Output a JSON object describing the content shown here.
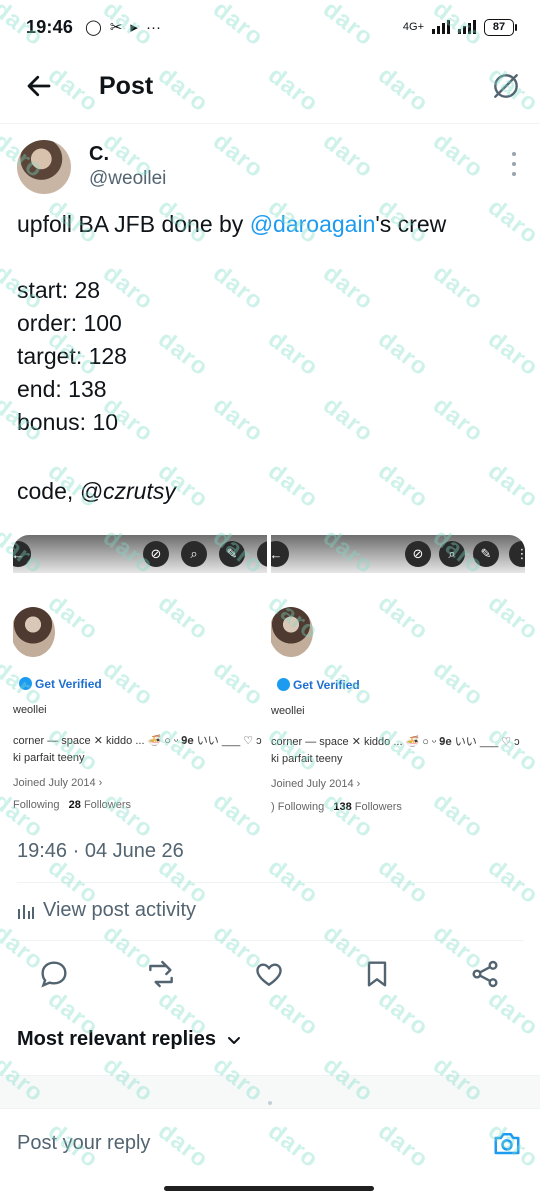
{
  "status_bar": {
    "time": "19:46",
    "network": "4G+",
    "battery": "87"
  },
  "header": {
    "title": "Post"
  },
  "post": {
    "author_name": "C.",
    "author_handle": "@weollei",
    "text_prefix": "upfoll BA JFB done by ",
    "mention": "@daroagain",
    "text_suffix": "'s crew",
    "body": "start: 28\norder: 100\ntarget: 128\nend: 138\nbonus: 10",
    "code_label": "code,",
    "code_value": "@czrutsy",
    "timestamp": "19:46 · 04 June 26",
    "activity": "View post activity"
  },
  "media": {
    "left": {
      "verified_label": "Get Verified",
      "handle": "weollei",
      "bio_line1": "corner — space ✕ kiddo ... 🍜 ○ ᵕ 𝟗𝐞 いい ___ ♡ ɔ",
      "bio_line2": "ki parfait teeny",
      "joined": "Joined July 2014",
      "following_label": "Following",
      "followers_count": "28",
      "followers_label": "Followers"
    },
    "right": {
      "verified_label": "Get Verified",
      "handle": "weollei",
      "bio_line1": "corner — space ✕ kiddo ... 🍜 ○ ᵕ 𝟗𝐞 いい ___ ♡ ɔ",
      "bio_line2": "ki parfait teeny",
      "joined": "Joined July 2014",
      "following_prefix": ")",
      "following_label": "Following",
      "followers_count": "138",
      "followers_label": "Followers"
    }
  },
  "replies": {
    "sort_label": "Most relevant replies",
    "input_placeholder": "Post your reply"
  },
  "watermark": "daro",
  "colors": {
    "accent": "#1d9bf0",
    "text": "#0f1419",
    "muted": "#536471",
    "watermark": "#7ddcc8"
  }
}
